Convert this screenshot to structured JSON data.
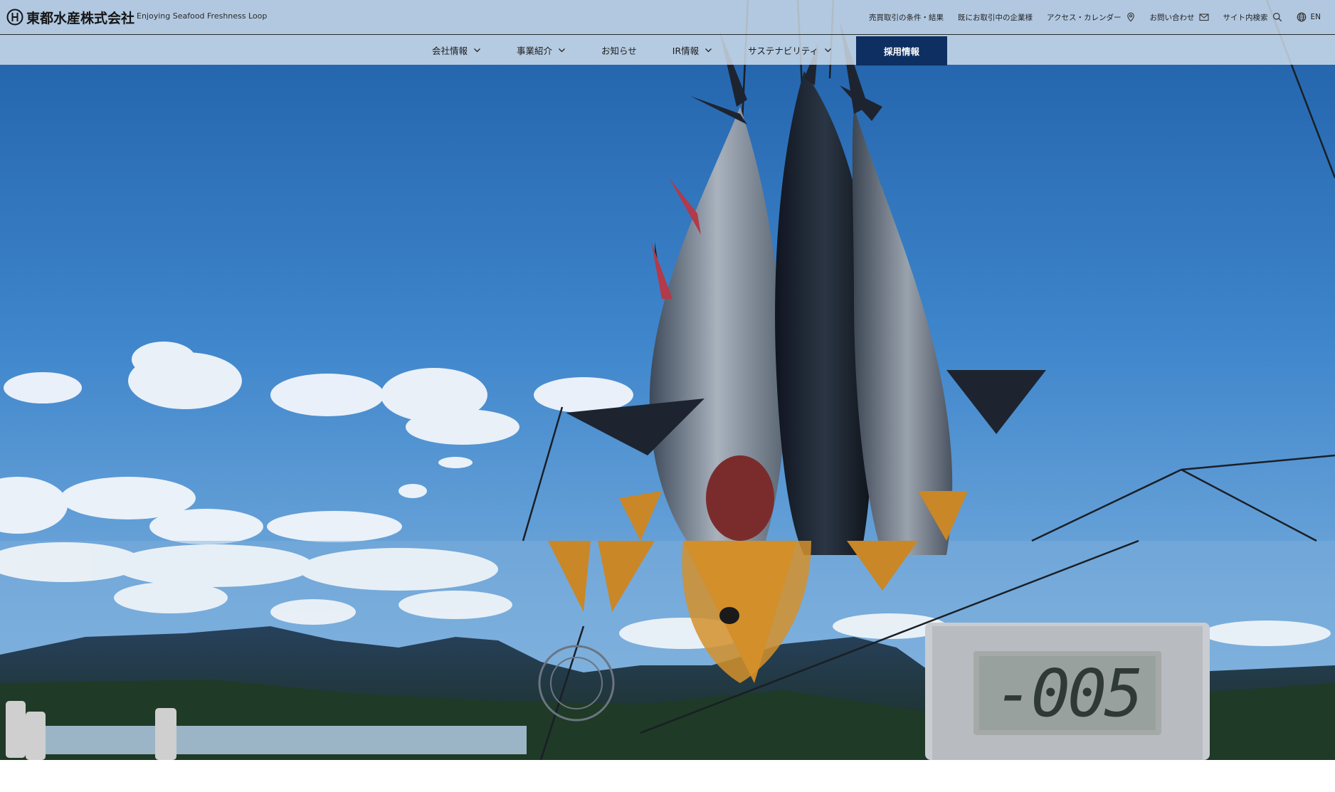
{
  "header": {
    "logo_text": "東都水産株式会社",
    "tagline": "Enjoying Seafood Freshness Loop",
    "utility_links": [
      {
        "label": "売買取引の条件・結果",
        "icon": ""
      },
      {
        "label": "既にお取引中の企業様",
        "icon": ""
      },
      {
        "label": "アクセス・カレンダー",
        "icon": "map-pin-icon"
      },
      {
        "label": "お問い合わせ",
        "icon": "mail-icon"
      },
      {
        "label": "サイト内検索",
        "icon": "search-icon"
      },
      {
        "label": "EN",
        "icon": "globe-icon"
      }
    ]
  },
  "nav": {
    "items": [
      {
        "label": "会社情報",
        "dropdown": true
      },
      {
        "label": "事業紹介",
        "dropdown": true
      },
      {
        "label": "お知らせ",
        "dropdown": false
      },
      {
        "label": "IR情報",
        "dropdown": true
      },
      {
        "label": "サステナビリティ",
        "dropdown": true
      }
    ],
    "recruit_label": "採用情報"
  },
  "hero": {
    "scale_reading": "-005"
  },
  "colors": {
    "nav_bg": "#d6e2ee",
    "recruit_bg": "#0e2f62",
    "sky": "#3f7fc2"
  }
}
